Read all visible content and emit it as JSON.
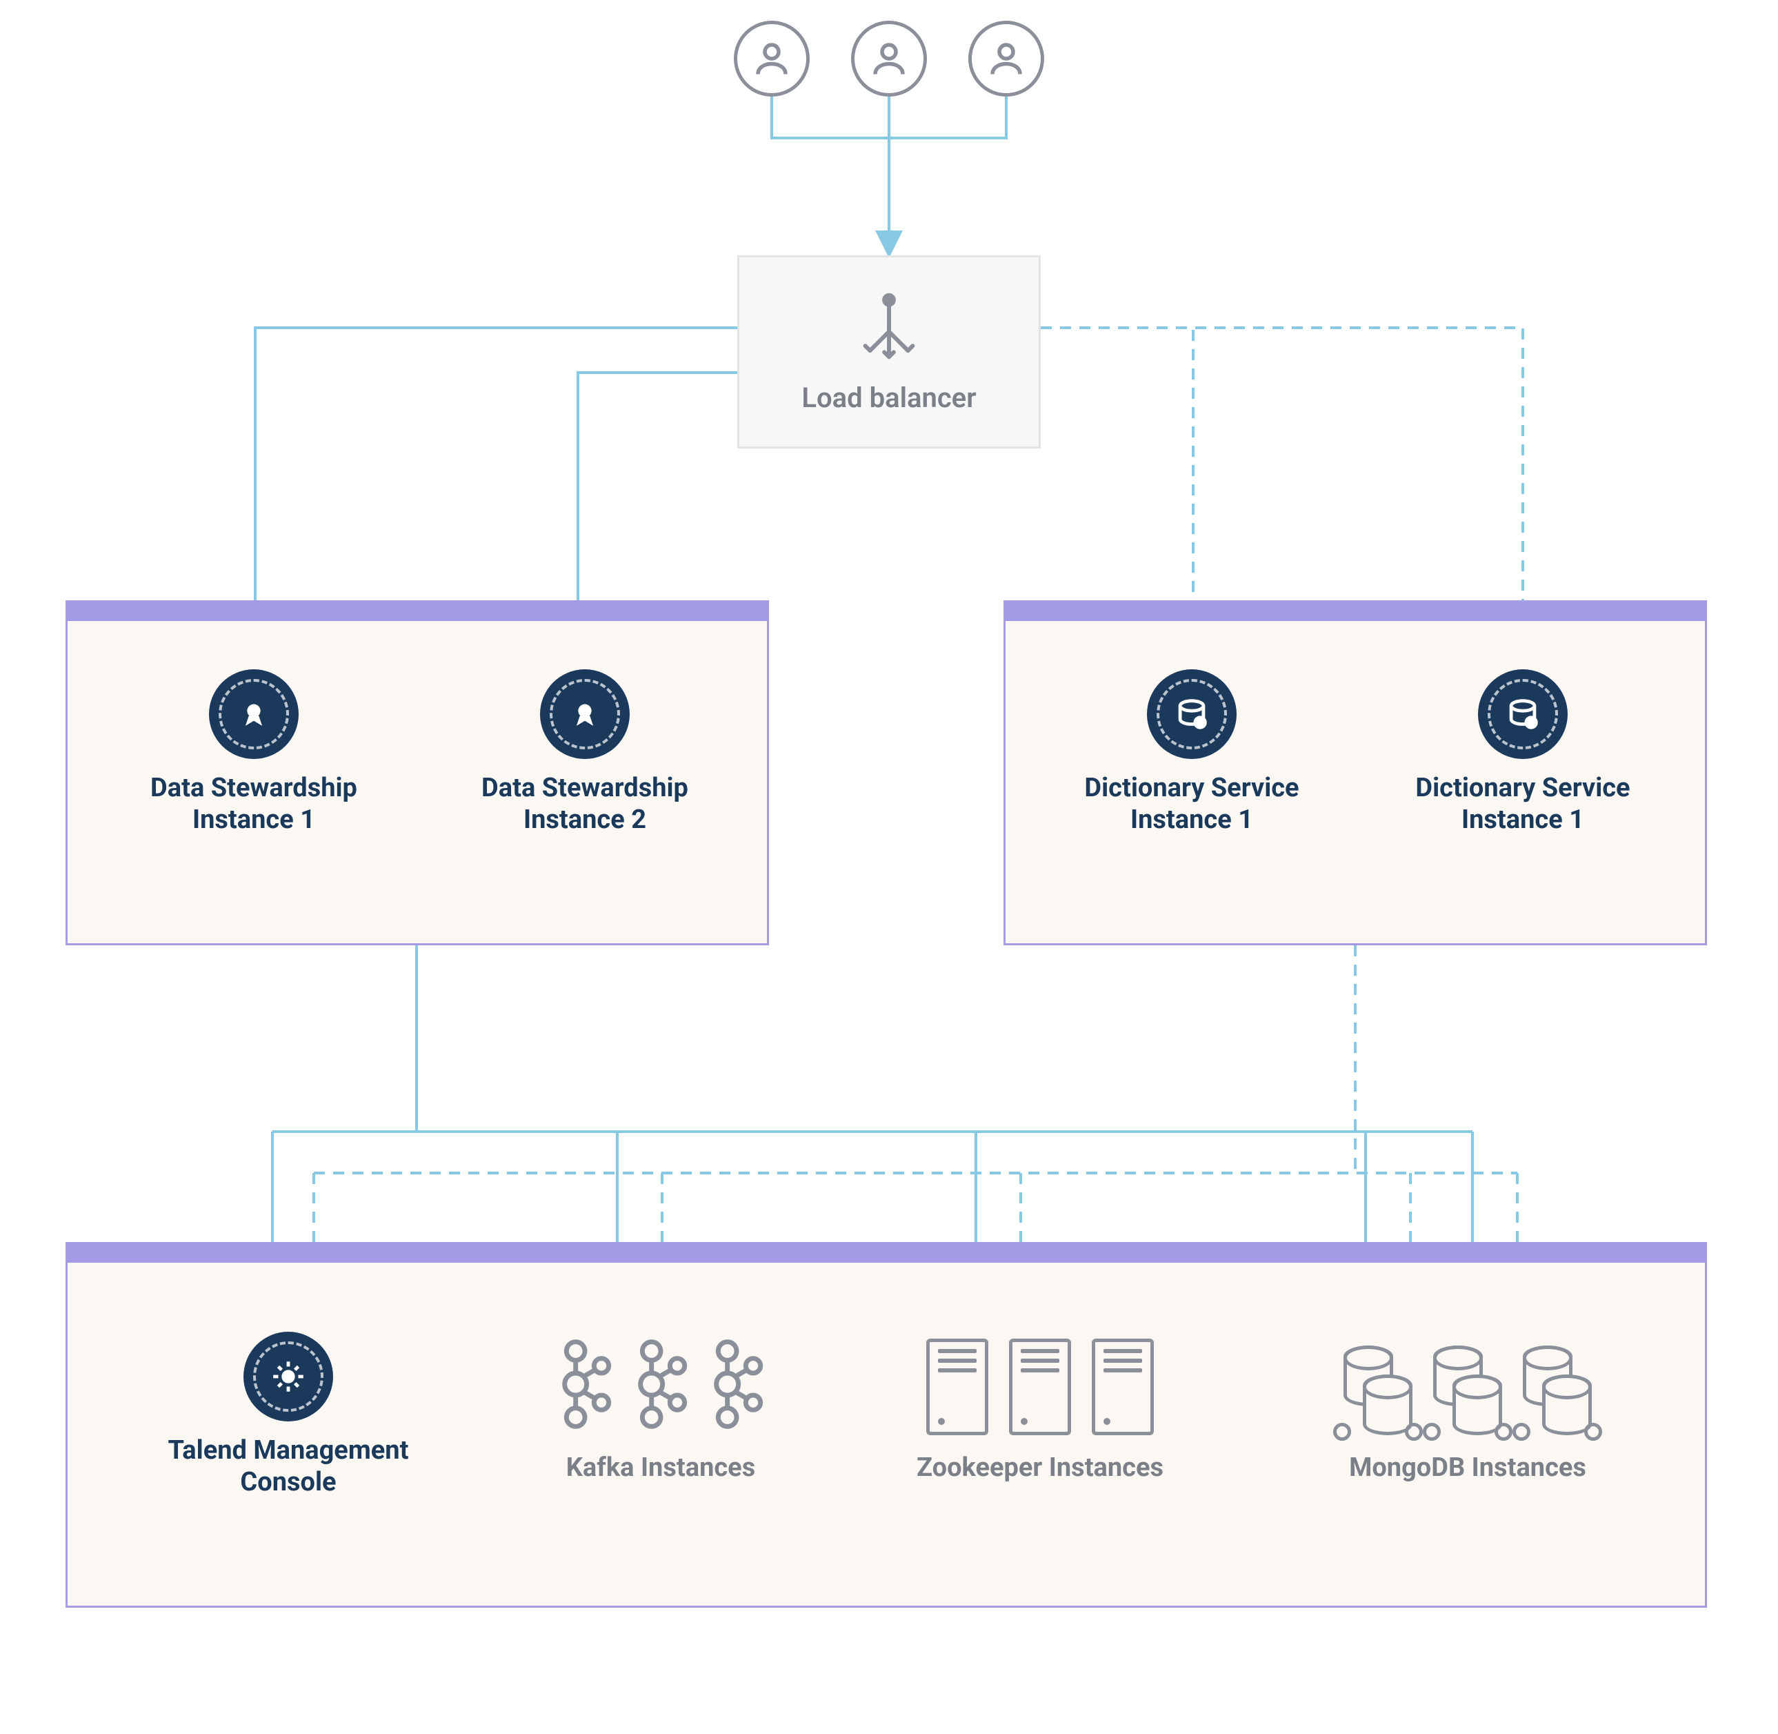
{
  "users": {
    "count": 3
  },
  "load_balancer": {
    "label": "Load balancer"
  },
  "stewardship": {
    "instances": [
      {
        "label": "Data Stewardship Instance 1"
      },
      {
        "label": "Data Stewardship Instance 2"
      }
    ]
  },
  "dictionary": {
    "instances": [
      {
        "label": "Dictionary Service Instance 1"
      },
      {
        "label": "Dictionary Service Instance 1"
      }
    ]
  },
  "bottom": {
    "tmc": {
      "label": "Talend Management Console"
    },
    "kafka": {
      "label": "Kafka Instances"
    },
    "zookeeper": {
      "label": "Zookeeper Instances"
    },
    "mongodb": {
      "label": "MongoDB Instances"
    }
  },
  "colors": {
    "line": "#87c8e4",
    "container_accent": "#a39be6",
    "badge": "#1b3a5b",
    "gray": "#8a8f99"
  }
}
